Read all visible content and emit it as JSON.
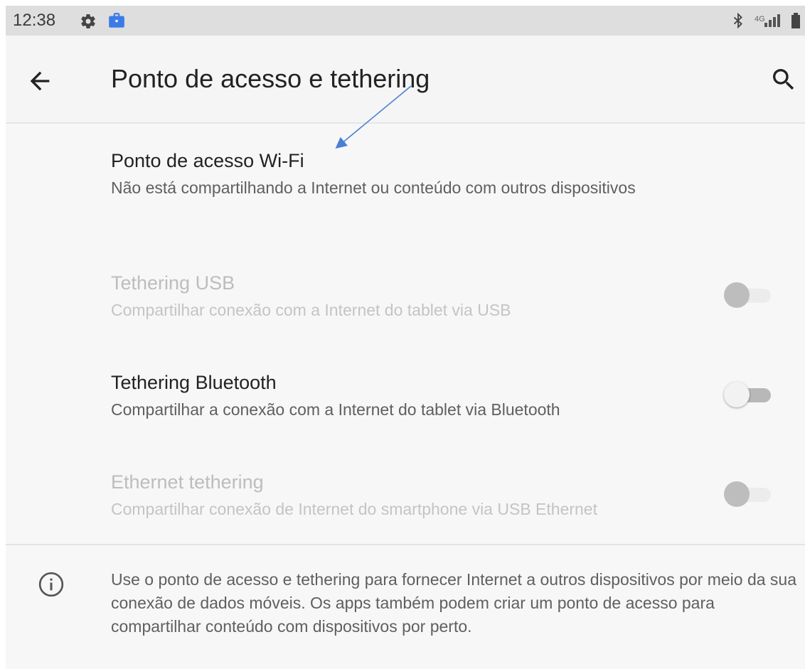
{
  "status_bar": {
    "time": "12:38",
    "icons": [
      "gear-icon",
      "work-briefcase-icon",
      "bluetooth-icon",
      "signal-icon",
      "battery-icon"
    ]
  },
  "app_bar": {
    "title": "Ponto de acesso e tethering",
    "back_icon": "arrow-left-icon",
    "search_icon": "search-icon"
  },
  "items": [
    {
      "title": "Ponto de acesso Wi-Fi",
      "subtitle": "Não está compartilhando a Internet ou conteúdo com outros dispositivos",
      "enabled": true,
      "has_toggle": false
    },
    {
      "title": "Tethering USB",
      "subtitle": "Compartilhar conexão com a Internet do tablet via USB",
      "enabled": false,
      "has_toggle": true,
      "toggle_on": false
    },
    {
      "title": "Tethering Bluetooth",
      "subtitle": "Compartilhar a conexão com a Internet do tablet via Bluetooth",
      "enabled": true,
      "has_toggle": true,
      "toggle_on": false
    },
    {
      "title": "Ethernet tethering",
      "subtitle": "Compartilhar conexão de Internet do smartphone via USB Ethernet",
      "enabled": false,
      "has_toggle": true,
      "toggle_on": false
    }
  ],
  "info": {
    "icon": "info-icon",
    "text": "Use o ponto de acesso e tethering para fornecer Internet a outros dispositivos por meio da sua conexão de dados móveis. Os apps também podem criar um ponto de acesso para compartilhar conteúdo com dispositivos por perto."
  },
  "colors": {
    "annotation_arrow": "#4a7fd6",
    "work_badge": "#3b7be8"
  }
}
